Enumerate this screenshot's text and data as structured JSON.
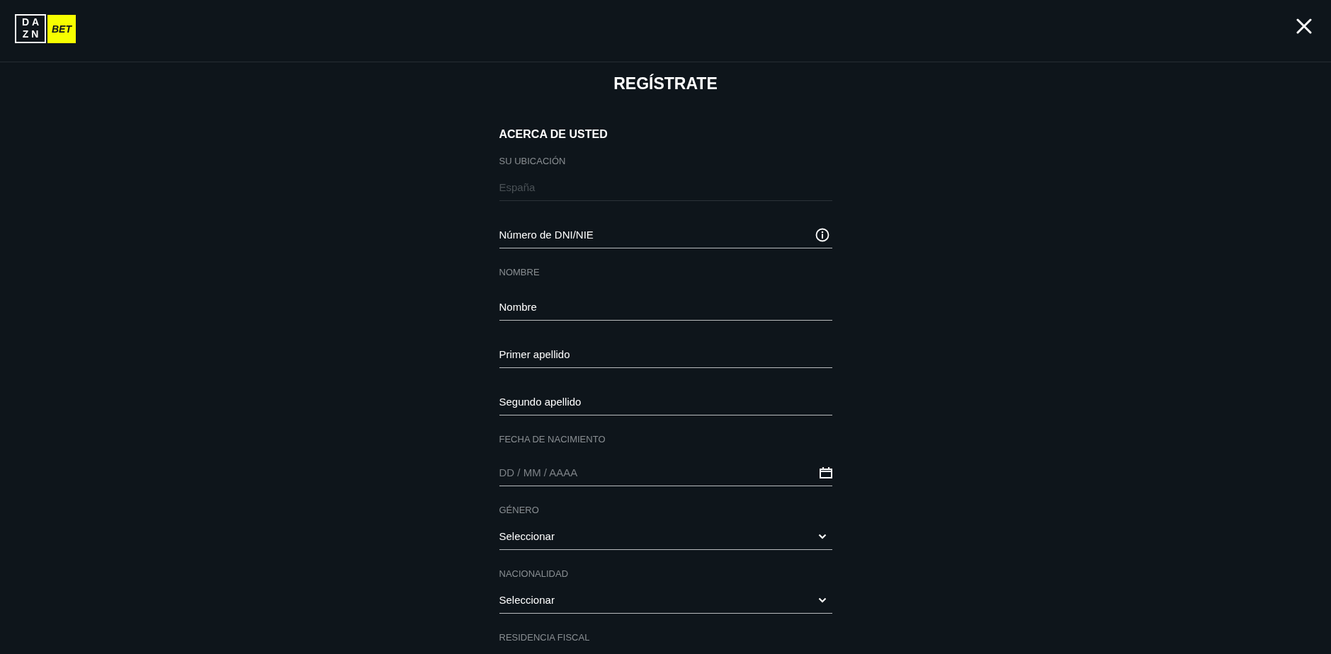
{
  "header": {
    "logo": {
      "mark": "DAZN",
      "tag": "BET"
    }
  },
  "title": "REGÍSTRATE",
  "section": {
    "heading": "ACERCA DE USTED",
    "items": [
      {
        "kind": "label",
        "text": "SU UBICACIÓN"
      },
      {
        "kind": "static",
        "value": "España",
        "disabled": true
      },
      {
        "kind": "text",
        "placeholder": "Número de DNI/NIE",
        "info_button": true
      },
      {
        "kind": "label",
        "text": "NOMBRE"
      },
      {
        "kind": "text",
        "placeholder": "Nombre",
        "info_button": false
      },
      {
        "kind": "text",
        "placeholder": "Primer apellido",
        "info_button": false
      },
      {
        "kind": "text",
        "placeholder": "Segundo apellido",
        "info_button": false
      },
      {
        "kind": "label",
        "text": "FECHA DE NACIMIENTO"
      },
      {
        "kind": "date",
        "placeholder": "DD / MM / AAAA"
      },
      {
        "kind": "label",
        "text": "GÉNERO"
      },
      {
        "kind": "select",
        "value": "Seleccionar"
      },
      {
        "kind": "label",
        "text": "NACIONALIDAD"
      },
      {
        "kind": "select",
        "value": "Seleccionar"
      },
      {
        "kind": "label",
        "text": "RESIDENCIA FISCAL"
      }
    ]
  }
}
